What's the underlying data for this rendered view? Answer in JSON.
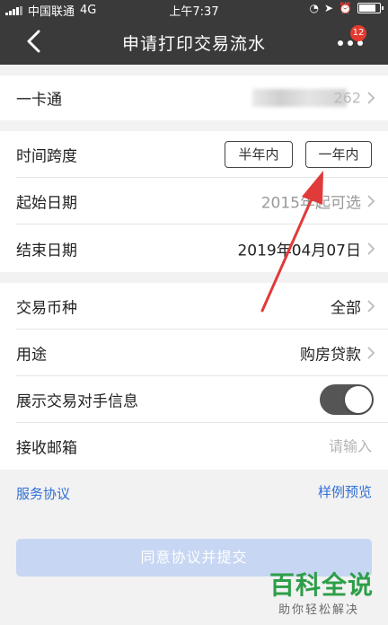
{
  "status_bar": {
    "carrier": "中国联通",
    "network": "4G",
    "time": "上午7:37",
    "battery_level_percent": 85
  },
  "nav": {
    "title": "申请打印交易流水",
    "badge_count": "12"
  },
  "form": {
    "card": {
      "label": "一卡通",
      "value_tail": "262"
    },
    "span": {
      "label": "时间跨度",
      "options": [
        "半年内",
        "一年内"
      ]
    },
    "start_date": {
      "label": "起始日期",
      "placeholder": "2015年起可选"
    },
    "end_date": {
      "label": "结束日期",
      "value": "2019年04月07日"
    },
    "currency": {
      "label": "交易币种",
      "value": "全部"
    },
    "purpose": {
      "label": "用途",
      "value": "购房贷款"
    },
    "show_counterparty": {
      "label": "展示交易对手信息",
      "enabled": true
    },
    "email": {
      "label": "接收邮箱",
      "placeholder": "请输入"
    }
  },
  "links": {
    "service_agreement": "服务协议",
    "sample_preview": "样例预览"
  },
  "submit_label": "同意协议并提交",
  "watermark": {
    "title": "百科全说",
    "subtitle": "助你轻松解决"
  },
  "colors": {
    "header_bg": "#3a3a3a",
    "link": "#2f6fd6",
    "submit_disabled": "#c7d6f2",
    "badge": "#e33a30",
    "annotation_arrow": "#e03a3a",
    "watermark": "#2e9e49"
  }
}
